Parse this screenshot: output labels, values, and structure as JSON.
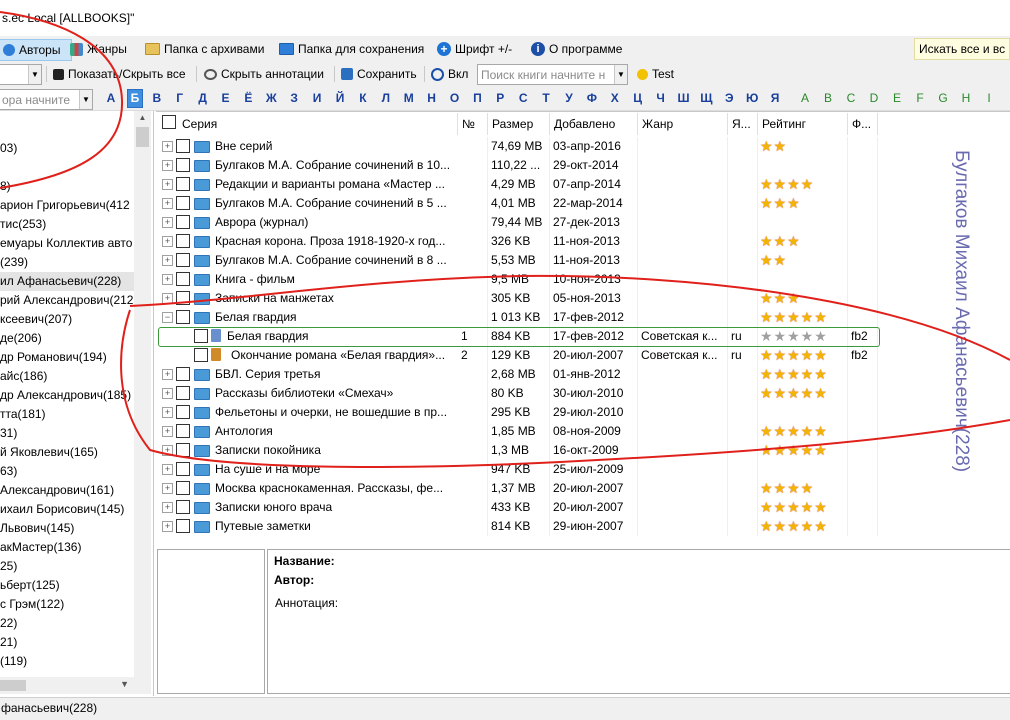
{
  "window": {
    "title": "s.ec Local [ALLBOOKS]\""
  },
  "toolbar": {
    "authors": "Авторы",
    "genres": "Жанры",
    "archive_folder": "Папка с архивами",
    "save_folder": "Папка для сохранения",
    "font": "Шрифт +/-",
    "about": "О программе",
    "search_all": "Искать все и вс"
  },
  "toolbar2": {
    "toggle_all": "Показать/Скрыть все",
    "annotations": "Скрыть аннотации",
    "save": "Сохранить",
    "on": "Вкл",
    "search_placeholder": "Поиск книги начните н",
    "test": "Test",
    "left_search_placeholder": "ора начните"
  },
  "alphabet": {
    "cyrillic": [
      "А",
      "Б",
      "В",
      "Г",
      "Д",
      "Е",
      "Ё",
      "Ж",
      "З",
      "И",
      "Й",
      "К",
      "Л",
      "М",
      "Н",
      "О",
      "П",
      "Р",
      "С",
      "Т",
      "У",
      "Ф",
      "Х",
      "Ц",
      "Ч",
      "Ш",
      "Щ",
      "Э",
      "Ю",
      "Я"
    ],
    "latin": [
      "A",
      "B",
      "C",
      "D",
      "E",
      "F",
      "G",
      "H",
      "I"
    ],
    "selected": "Б"
  },
  "authors_list": [
    "03)",
    "",
    "8)",
    "арион Григорьевич(412",
    "тис(253)",
    "емуары Коллектив авто",
    "(239)",
    "ил Афанасьевич(228)",
    "рий Александрович(212",
    "ксеевич(207)",
    "де(206)",
    "др Романович(194)",
    "айс(186)",
    "др Александрович(185)",
    "тта(181)",
    "31)",
    "й Яковлевич(165)",
    "63)",
    "Александрович(161)",
    "ихаил Борисович(145)",
    "Львович(145)",
    "акМастер(136)",
    "25)",
    "ьберт(125)",
    "с Грэм(122)",
    "22)",
    "21)",
    "(119)"
  ],
  "grid": {
    "columns": [
      "Серия",
      "№",
      "Размер",
      "Добавлено",
      "Жанр",
      "Я...",
      "Рейтинг",
      "Ф..."
    ],
    "rows": [
      {
        "name": "Вне серий",
        "num": "",
        "size": "74,69 MB",
        "added": "03-апр-2016",
        "genre": "",
        "lang": "",
        "rating": 2,
        "fmt": ""
      },
      {
        "name": "Булгаков М.А. Собрание сочинений в 10...",
        "num": "",
        "size": "110,22 ...",
        "added": "29-окт-2014",
        "genre": "",
        "lang": "",
        "rating": 0,
        "fmt": ""
      },
      {
        "name": "Редакции и варианты романа «Мастер ...",
        "num": "",
        "size": "4,29 MB",
        "added": "07-апр-2014",
        "genre": "",
        "lang": "",
        "rating": 4,
        "fmt": ""
      },
      {
        "name": "Булгаков М.А. Собрание сочинений в 5 ...",
        "num": "",
        "size": "4,01 MB",
        "added": "22-мар-2014",
        "genre": "",
        "lang": "",
        "rating": 3,
        "fmt": ""
      },
      {
        "name": "Аврора (журнал)",
        "num": "",
        "size": "79,44 MB",
        "added": "27-дек-2013",
        "genre": "",
        "lang": "",
        "rating": 0,
        "fmt": ""
      },
      {
        "name": "Красная корона. Проза 1918-1920-х год...",
        "num": "",
        "size": "326 KB",
        "added": "11-ноя-2013",
        "genre": "",
        "lang": "",
        "rating": 3,
        "fmt": ""
      },
      {
        "name": "Булгаков М.А. Собрание сочинений в 8 ...",
        "num": "",
        "size": "5,53 MB",
        "added": "11-ноя-2013",
        "genre": "",
        "lang": "",
        "rating": 2,
        "fmt": ""
      },
      {
        "name": "Книга - фильм",
        "num": "",
        "size": "9,5 MB",
        "added": "10-ноя-2013",
        "genre": "",
        "lang": "",
        "rating": 0,
        "fmt": ""
      },
      {
        "name": "Записки на манжетах",
        "num": "",
        "size": "305 KB",
        "added": "05-ноя-2013",
        "genre": "",
        "lang": "",
        "rating": 3,
        "fmt": ""
      },
      {
        "name": "Белая гвардия",
        "num": "",
        "size": "1 013 KB",
        "added": "17-фев-2012",
        "genre": "",
        "lang": "",
        "rating": 5,
        "fmt": ""
      },
      {
        "name": "Белая гвардия",
        "num": "1",
        "size": "884 KB",
        "added": "17-фев-2012",
        "genre": "Советская к...",
        "lang": "ru",
        "rating": 0,
        "fmt": "fb2"
      },
      {
        "name": "Окончание романа «Белая гвардия»...",
        "num": "2",
        "size": "129 KB",
        "added": "20-июл-2007",
        "genre": "Советская к...",
        "lang": "ru",
        "rating": 5,
        "fmt": "fb2"
      },
      {
        "name": "БВЛ. Серия третья",
        "num": "",
        "size": "2,68 MB",
        "added": "01-янв-2012",
        "genre": "",
        "lang": "",
        "rating": 5,
        "fmt": ""
      },
      {
        "name": "Рассказы библиотеки «Смехач»",
        "num": "",
        "size": "80 KB",
        "added": "30-июл-2010",
        "genre": "",
        "lang": "",
        "rating": 5,
        "fmt": ""
      },
      {
        "name": "Фельетоны и очерки, не вошедшие в пр...",
        "num": "",
        "size": "295 KB",
        "added": "29-июл-2010",
        "genre": "",
        "lang": "",
        "rating": 0,
        "fmt": ""
      },
      {
        "name": "Антология",
        "num": "",
        "size": "1,85 MB",
        "added": "08-ноя-2009",
        "genre": "",
        "lang": "",
        "rating": 5,
        "fmt": ""
      },
      {
        "name": "Записки покойника",
        "num": "",
        "size": "1,3 MB",
        "added": "16-окт-2009",
        "genre": "",
        "lang": "",
        "rating": 5,
        "fmt": ""
      },
      {
        "name": "На суше и на море",
        "num": "",
        "size": "947 KB",
        "added": "25-июл-2009",
        "genre": "",
        "lang": "",
        "rating": 0,
        "fmt": ""
      },
      {
        "name": "Москва краснокаменная. Рассказы, фе...",
        "num": "",
        "size": "1,37 MB",
        "added": "20-июл-2007",
        "genre": "",
        "lang": "",
        "rating": 4,
        "fmt": ""
      },
      {
        "name": "Записки юного врача",
        "num": "",
        "size": "433 KB",
        "added": "20-июл-2007",
        "genre": "",
        "lang": "",
        "rating": 5,
        "fmt": ""
      },
      {
        "name": "Путевые заметки",
        "num": "",
        "size": "814 KB",
        "added": "29-июн-2007",
        "genre": "",
        "lang": "",
        "rating": 5,
        "fmt": ""
      }
    ]
  },
  "details": {
    "title_label": "Название:",
    "author_label": "Автор:",
    "annotation_label": "Аннотация:"
  },
  "vertical_caption": "Булгаков Михаил Афанасьевич(228)",
  "status": {
    "text": "фанасьевич(228)"
  },
  "colors": {
    "accent": "#3f8fe0",
    "annotation_red": "#e0201a",
    "caption": "#6a6ab0"
  }
}
